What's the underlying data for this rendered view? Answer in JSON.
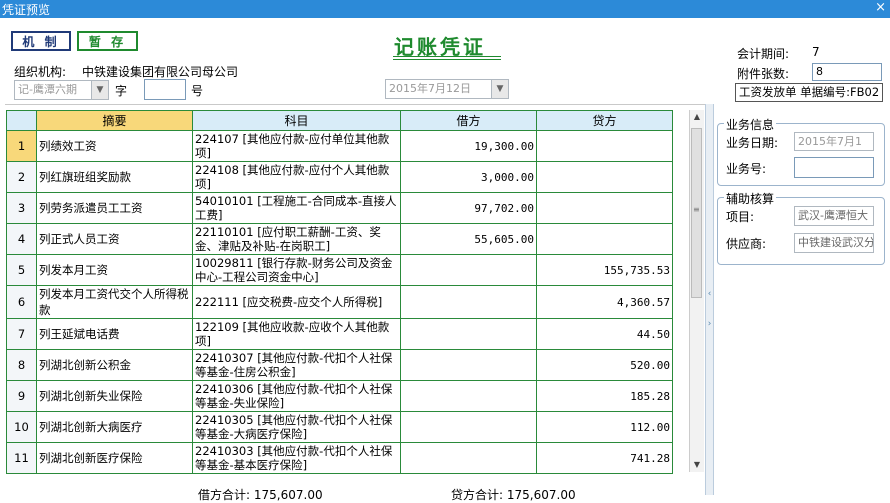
{
  "window": {
    "title": "凭证预览",
    "close_glyph": "×"
  },
  "toolbar": {
    "jizhi_label": "机 制",
    "zancun_label": "暂 存"
  },
  "voucher": {
    "title": "记账凭证",
    "org_label": "组织机构:",
    "org_value": "中铁建设集团有限公司母公司",
    "type_value": "记-鹰潭六期",
    "zi_label": "字",
    "number_value": "",
    "hao_label": "号",
    "date_value": "2015年7月12日",
    "period_label": "会计期间:",
    "period_value": "7",
    "attach_label": "附件张数:",
    "attach_value": "8",
    "doc_label": "工资发放单  单据编号:FB02"
  },
  "grid": {
    "headers": [
      "摘要",
      "科目",
      "借方",
      "贷方"
    ],
    "rows": [
      {
        "no": "1",
        "summary": "列绩效工资",
        "account": "224107 [其他应付款-应付单位其他款项]",
        "debit": "19,300.00",
        "credit": ""
      },
      {
        "no": "2",
        "summary": "列红旗班组奖励款",
        "account": "224108 [其他应付款-应付个人其他款项]",
        "debit": "3,000.00",
        "credit": ""
      },
      {
        "no": "3",
        "summary": "列劳务派遣员工工资",
        "account": "54010101 [工程施工-合同成本-直接人工费]",
        "debit": "97,702.00",
        "credit": ""
      },
      {
        "no": "4",
        "summary": "列正式人员工资",
        "account": "22110101 [应付职工薪酬-工资、奖金、津贴及补贴-在岗职工]",
        "debit": "55,605.00",
        "credit": ""
      },
      {
        "no": "5",
        "summary": "列发本月工资",
        "account": "10029811 [银行存款-财务公司及资金中心-工程公司资金中心]",
        "debit": "",
        "credit": "155,735.53"
      },
      {
        "no": "6",
        "summary": "列发本月工资代交个人所得税款",
        "account": "222111 [应交税费-应交个人所得税]",
        "debit": "",
        "credit": "4,360.57"
      },
      {
        "no": "7",
        "summary": "列王延斌电话费",
        "account": "122109 [其他应收款-应收个人其他款项]",
        "debit": "",
        "credit": "44.50"
      },
      {
        "no": "8",
        "summary": "列湖北创新公积金",
        "account": "22410307 [其他应付款-代扣个人社保等基金-住房公积金]",
        "debit": "",
        "credit": "520.00"
      },
      {
        "no": "9",
        "summary": "列湖北创新失业保险",
        "account": "22410306 [其他应付款-代扣个人社保等基金-失业保险]",
        "debit": "",
        "credit": "185.28"
      },
      {
        "no": "10",
        "summary": "列湖北创新大病医疗",
        "account": "22410305 [其他应付款-代扣个人社保等基金-大病医疗保险]",
        "debit": "",
        "credit": "112.00"
      },
      {
        "no": "11",
        "summary": "列湖北创新医疗保险",
        "account": "22410303 [其他应付款-代扣个人社保等基金-基本医疗保险]",
        "debit": "",
        "credit": "741.28"
      }
    ]
  },
  "totals": {
    "debit_label": "借方合计:",
    "debit_value": "175,607.00",
    "credit_label": "贷方合计:",
    "credit_value": "175,607.00"
  },
  "business": {
    "title": "业务信息",
    "date_label": "业务日期:",
    "date_value": "2015年7月1",
    "no_label": "业务号:",
    "no_value": ""
  },
  "aux": {
    "title": "辅助核算",
    "project_label": "项目:",
    "project_value": "武汉-鹰潭恒大",
    "supplier_label": "供应商:",
    "supplier_value": "中铁建设武汉分"
  },
  "colors": {
    "titlebar": "#2c8ad8",
    "grid_border": "#2a8a3a",
    "title_green": "#1f8a2e",
    "header_bg": "#d8ecf8",
    "selected": "#f8d87a"
  }
}
